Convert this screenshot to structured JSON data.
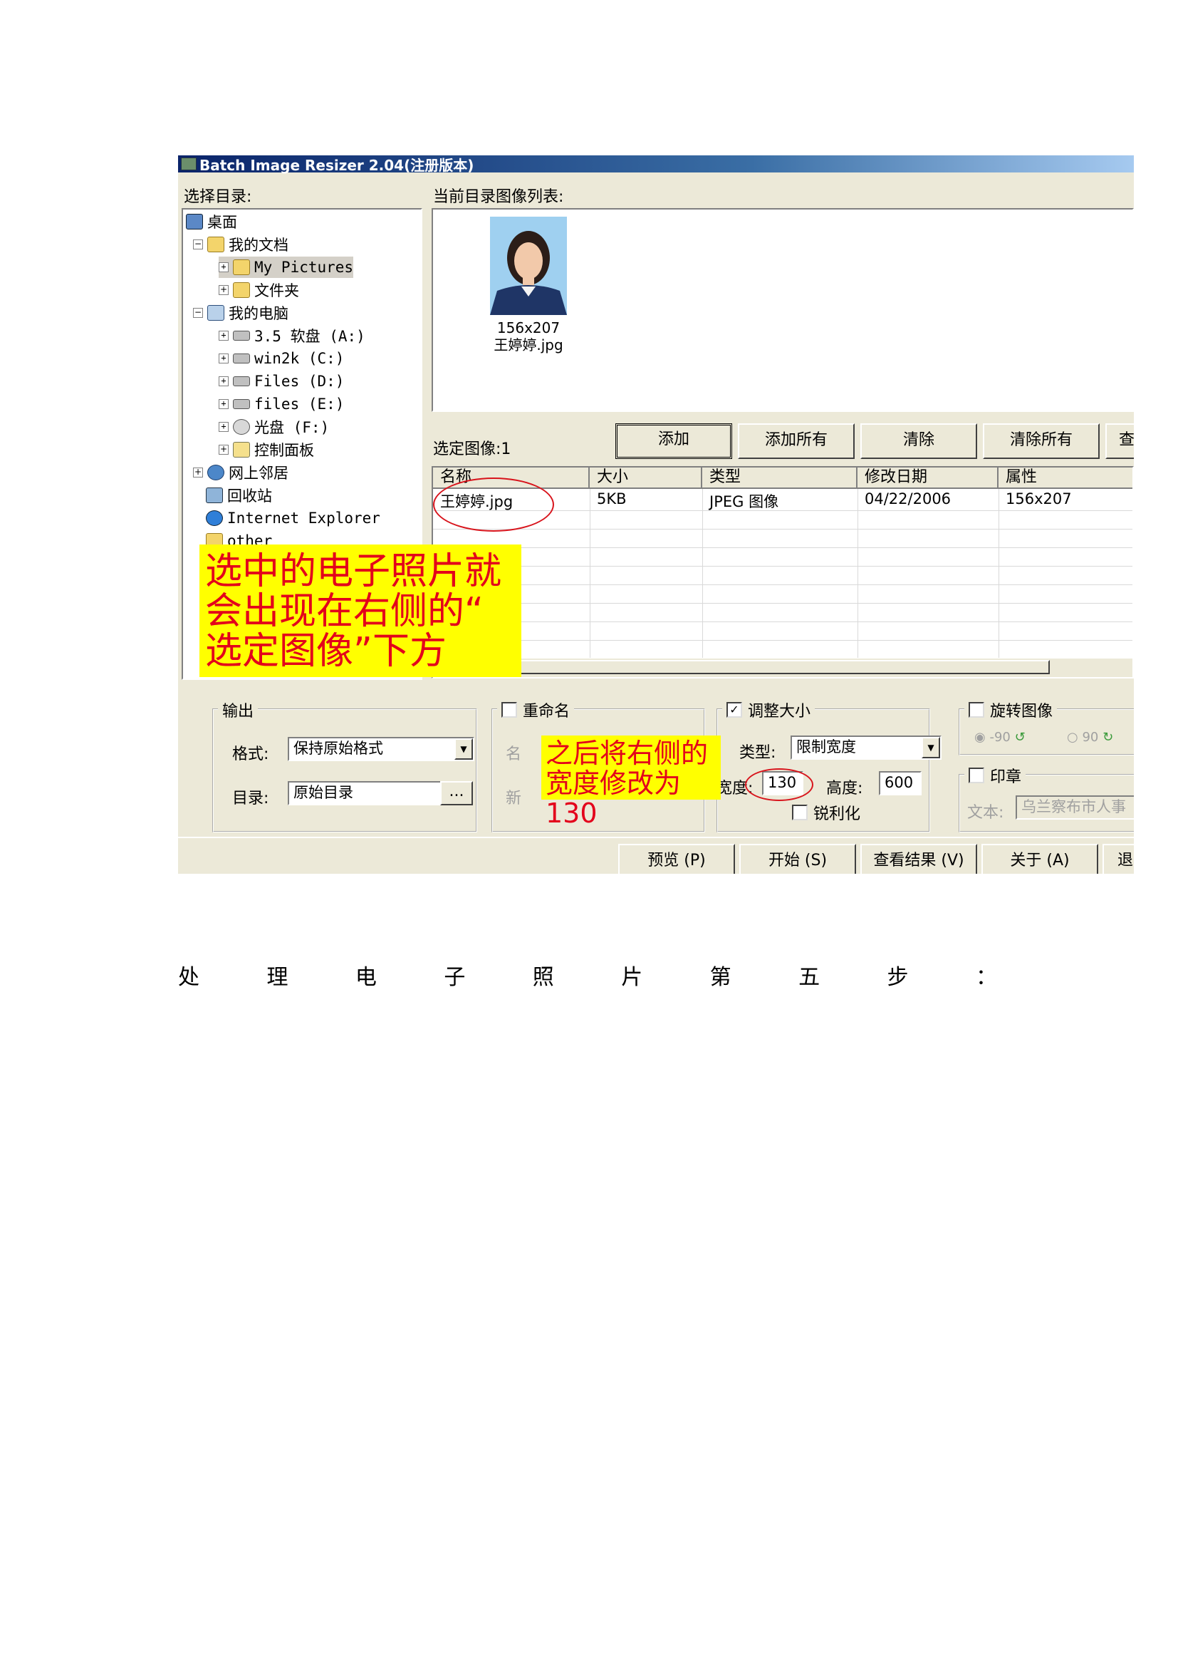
{
  "window": {
    "title": "Batch Image Resizer 2.04(注册版本)"
  },
  "left_panel": {
    "label": "选择目录:"
  },
  "tree": [
    {
      "label": "桌面",
      "icon": "desktop-icon"
    },
    {
      "label": "我的文档",
      "icon": "folder-icon"
    },
    {
      "label": "My Pictures",
      "icon": "folder-icon"
    },
    {
      "label": "文件夹",
      "icon": "folder-icon"
    },
    {
      "label": "我的电脑",
      "icon": "computer-icon"
    },
    {
      "label": "3.5 软盘 (A:)",
      "icon": "floppy-icon"
    },
    {
      "label": "win2k (C:)",
      "icon": "drive-icon"
    },
    {
      "label": "Files (D:)",
      "icon": "drive-icon"
    },
    {
      "label": "files (E:)",
      "icon": "drive-icon"
    },
    {
      "label": "光盘 (F:)",
      "icon": "cdrom-icon"
    },
    {
      "label": "控制面板",
      "icon": "control-panel-icon"
    },
    {
      "label": "网上邻居",
      "icon": "network-icon"
    },
    {
      "label": "回收站",
      "icon": "recycle-bin-icon"
    },
    {
      "label": "Internet Explorer",
      "icon": "ie-icon"
    },
    {
      "label": "other",
      "icon": "folder-icon"
    }
  ],
  "image_list": {
    "label": "当前目录图像列表:",
    "thumb_size": "156x207",
    "thumb_name": "王婷婷.jpg"
  },
  "selected": {
    "label": "选定图像:1",
    "buttons": [
      "添加",
      "添加所有",
      "清除",
      "清除所有",
      "查"
    ],
    "columns": [
      "名称",
      "大小",
      "类型",
      "修改日期",
      "属性"
    ],
    "rows": [
      [
        "王婷婷.jpg",
        "5KB",
        "JPEG 图像",
        "04/22/2006",
        "156x207"
      ]
    ]
  },
  "output": {
    "title": "输出",
    "format_label": "格式:",
    "format_value": "保持原始格式",
    "dir_label": "目录:",
    "dir_value": "原始目录",
    "browse": "..."
  },
  "rename": {
    "title": "重命名",
    "hidden_1": "名",
    "hidden_2": "新"
  },
  "resize": {
    "title": "调整大小",
    "checked": "✓",
    "type_label": "类型:",
    "type_value": "限制宽度",
    "width_label": "宽度:",
    "width_value": "130",
    "height_label": "高度:",
    "height_value": "600",
    "sharpen": "锐利化"
  },
  "rotate": {
    "title": "旋转图像",
    "opt1": "-90",
    "opt2": "90"
  },
  "stamp": {
    "title": "印章",
    "text_label": "文本:",
    "text_value": "乌兰察布市人事"
  },
  "bottom_buttons": [
    "预览 (P)",
    "开始 (S)",
    "查看结果 (V)",
    "关于 (A)",
    "退"
  ],
  "annotations": {
    "note1": [
      "选中的电子照片就",
      "会出现在右侧的“",
      "选定图像”下方"
    ],
    "note2": [
      "之后将右侧的",
      "宽度修改为130"
    ]
  },
  "caption": [
    "处",
    "理",
    "电",
    "子",
    "照",
    "片",
    "第",
    "五",
    "步",
    "："
  ]
}
